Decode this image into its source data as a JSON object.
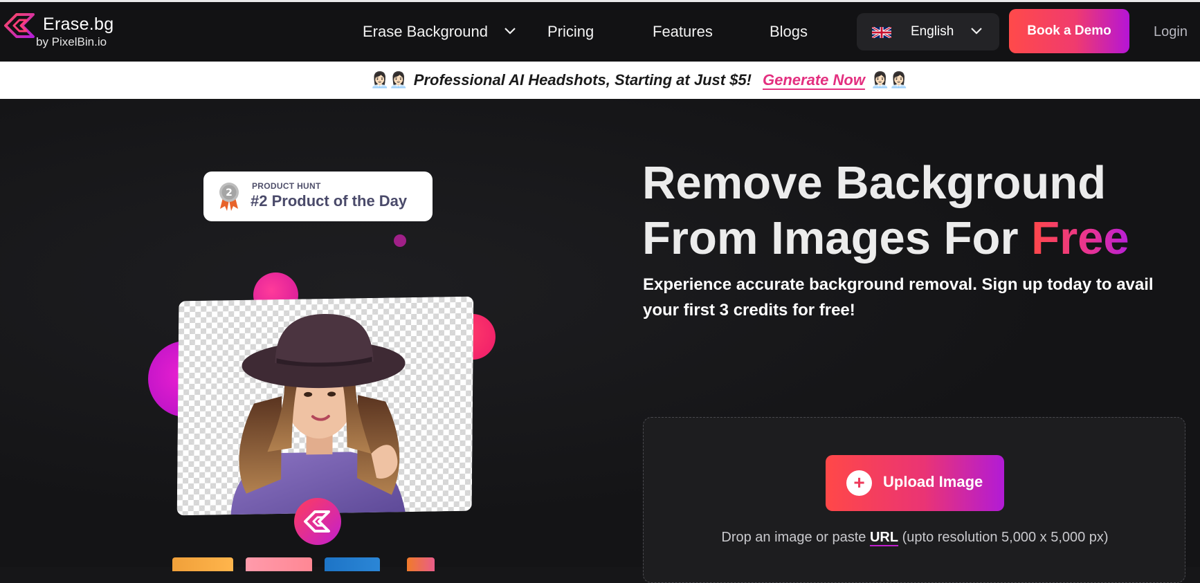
{
  "brand": {
    "name": "Erase.bg",
    "sub": "by PixelBin.io"
  },
  "nav": {
    "items": [
      {
        "label": "Erase Background"
      },
      {
        "label": "Pricing"
      },
      {
        "label": "Features"
      },
      {
        "label": "Blogs"
      }
    ],
    "language": "English",
    "demo_label": "Book a Demo",
    "login_label": "Login"
  },
  "promo": {
    "emoji": "👩🏻‍💼👩🏻‍💼",
    "text": "Professional AI Headshots, Starting at Just $5!",
    "link": "Generate Now"
  },
  "badge": {
    "kicker": "PRODUCT HUNT",
    "title": "#2 Product of the Day",
    "rank": "2"
  },
  "hero": {
    "title_line1": "Remove Background",
    "title_line2": "From Images For ",
    "title_accent": "Free",
    "subtitle": "Experience accurate background removal. Sign up today to avail your first 3 credits for free!"
  },
  "upload": {
    "button_label": "Upload Image",
    "drop_prefix": "Drop an image or paste ",
    "url_label": "URL",
    "drop_suffix": " (upto resolution 5,000 x 5,000 px)"
  },
  "colors": {
    "accent_red": "#ff4848",
    "accent_pink": "#e83394",
    "accent_purple": "#b61fd8",
    "background": "#161618"
  },
  "icons": [
    "erase-bg-logo-icon",
    "chevron-down-icon",
    "uk-flag-icon",
    "medal-icon",
    "plus-icon"
  ]
}
